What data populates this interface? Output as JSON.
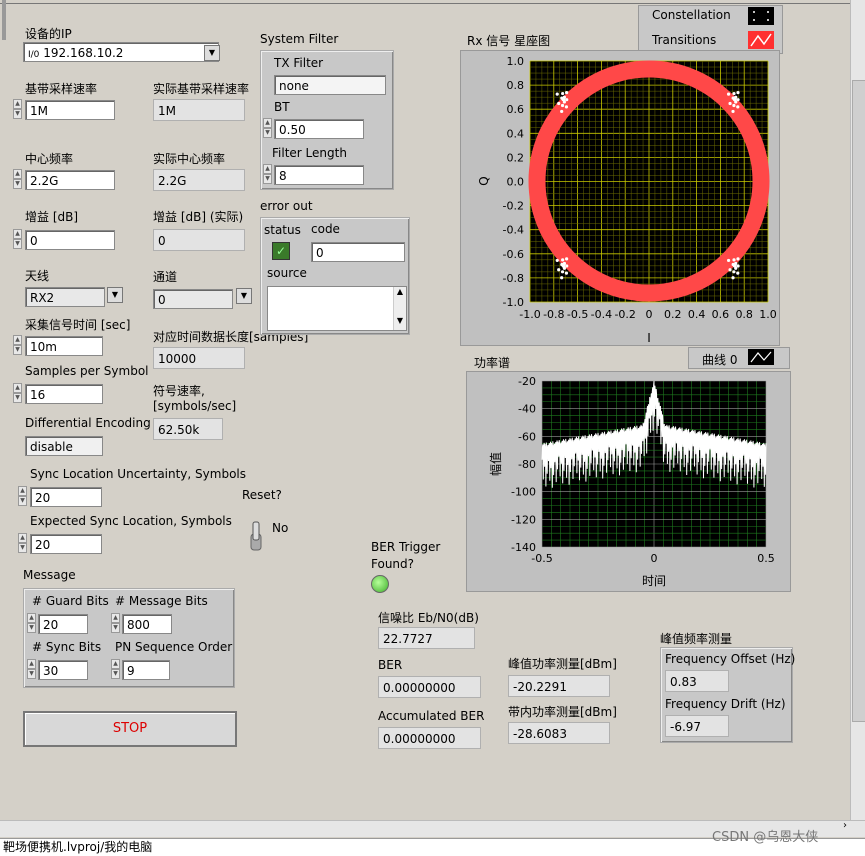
{
  "device_ip": {
    "label": "设备的IP",
    "value": "192.168.10.2",
    "prefix": "I/0"
  },
  "baseband_rate": {
    "label": "基带采样速率",
    "value": "1M"
  },
  "actual_baseband_rate": {
    "label": "实际基带采样速率",
    "value": "1M"
  },
  "center_freq": {
    "label": "中心频率",
    "value": "2.2G"
  },
  "actual_center_freq": {
    "label": "实际中心频率",
    "value": "2.2G"
  },
  "gain": {
    "label": "增益 [dB]",
    "value": "0"
  },
  "actual_gain": {
    "label": "增益 [dB] (实际)",
    "value": "0"
  },
  "antenna": {
    "label": "天线",
    "value": "RX2"
  },
  "channel": {
    "label": "通道",
    "value": "0"
  },
  "capture_time": {
    "label": "采集信号时间 [sec]",
    "value": "10m"
  },
  "samples_len": {
    "label": "对应时间数据长度[samples]",
    "value": "10000"
  },
  "samples_per_symbol": {
    "label": "Samples per Symbol",
    "value": "16"
  },
  "symbol_rate": {
    "label1": "符号速率,",
    "label2": "[symbols/sec]",
    "value": "62.50k"
  },
  "diff_encoding": {
    "label": "Differential Encoding",
    "value": "disable"
  },
  "sync_uncertainty": {
    "label": "Sync Location Uncertainty, Symbols",
    "value": "20"
  },
  "expected_sync": {
    "label": "Expected Sync Location, Symbols",
    "value": "20"
  },
  "reset": {
    "label": "Reset?",
    "value": "No"
  },
  "message": {
    "label": "Message",
    "guard_bits": {
      "label": "# Guard Bits",
      "value": "20"
    },
    "message_bits": {
      "label": "# Message Bits",
      "value": "800"
    },
    "sync_bits": {
      "label": "# Sync Bits",
      "value": "30"
    },
    "pn_order": {
      "label": "PN Sequence Order",
      "value": "9"
    }
  },
  "stop_label": "STOP",
  "system_filter": {
    "label": "System Filter",
    "tx_filter": {
      "label": "TX Filter",
      "value": "none"
    },
    "bt": {
      "label": "BT",
      "value": "0.50"
    },
    "filter_length": {
      "label": "Filter Length",
      "value": "8"
    }
  },
  "error_out": {
    "label": "error out",
    "status_label": "status",
    "code_label": "code",
    "code_value": "0",
    "source_label": "source",
    "status_mark": "✓"
  },
  "constellation": {
    "title": "Rx 信号 星座图",
    "legend": [
      {
        "label": "Constellation",
        "color": "#ffffff"
      },
      {
        "label": "Transitions",
        "color": "#ff4444"
      }
    ],
    "xlabel": "I",
    "ylabel": "Q",
    "ticks": [
      "-1.0",
      "-0.8",
      "-0.6",
      "-0.4",
      "-0.2",
      "0.0",
      "0.2",
      "0.4",
      "0.6",
      "0.8",
      "1.0"
    ],
    "xticks": [
      "-1.0",
      "-0.8",
      "-0.5",
      "-0.4",
      "-0.2",
      "0",
      "0.2",
      "0.4",
      "0.6",
      "0.8",
      "1.0"
    ],
    "yticks": [
      "1.0",
      "0.8",
      "0.6",
      "0.4",
      "0.2",
      "0.0",
      "-0.2",
      "-0.4",
      "-0.6",
      "-0.8",
      "-1.0"
    ]
  },
  "spectrum": {
    "title": "功率谱",
    "legend_label": "曲线 0",
    "xlabel": "时间",
    "ylabel": "幅值",
    "xticks": [
      "-0.5",
      "0",
      "0.5"
    ],
    "yticks": [
      "-20",
      "-40",
      "-60",
      "-80",
      "-100",
      "-120",
      "-140"
    ]
  },
  "ber_trigger": {
    "label1": "BER Trigger",
    "label2": "Found?",
    "led_color": "#5fd43a"
  },
  "snr": {
    "label": "信噪比 Eb/N0(dB)",
    "value": "22.7727"
  },
  "ber": {
    "label": "BER",
    "value": "0.00000000"
  },
  "accum_ber": {
    "label": "Accumulated BER",
    "value": "0.00000000"
  },
  "peak_power": {
    "label": "峰值功率测量[dBm]",
    "value": "-20.2291"
  },
  "band_power": {
    "label": "带内功率测量[dBm]",
    "value": "-28.6083"
  },
  "peak_freq": {
    "label": "峰值频率测量",
    "offset_label": "Frequency Offset (Hz)",
    "offset_value": "0.83",
    "drift_label": "Frequency Drift (Hz)",
    "drift_value": "-6.97"
  },
  "status_bar": "靶场便携机.lvproj/我的电脑",
  "watermark": "CSDN @乌恩大侠",
  "chart_data": [
    {
      "type": "scatter",
      "title": "Rx 信号 星座图",
      "xlabel": "I",
      "ylabel": "Q",
      "xlim": [
        -1,
        1
      ],
      "ylim": [
        -1,
        1
      ],
      "series": [
        {
          "name": "Transitions",
          "shape": "circle",
          "radius": 0.93
        },
        {
          "name": "Constellation",
          "points": [
            [
              -0.72,
              0.68
            ],
            [
              0.72,
              0.68
            ],
            [
              -0.72,
              -0.7
            ],
            [
              0.72,
              -0.7
            ]
          ]
        }
      ]
    },
    {
      "type": "line",
      "title": "功率谱",
      "xlabel": "时间",
      "ylabel": "幅值",
      "xlim": [
        -0.5,
        0.5
      ],
      "ylim": [
        -140,
        -20
      ],
      "series": [
        {
          "name": "曲线 0",
          "peak_x": 0,
          "peak_y": -20
        }
      ]
    }
  ]
}
